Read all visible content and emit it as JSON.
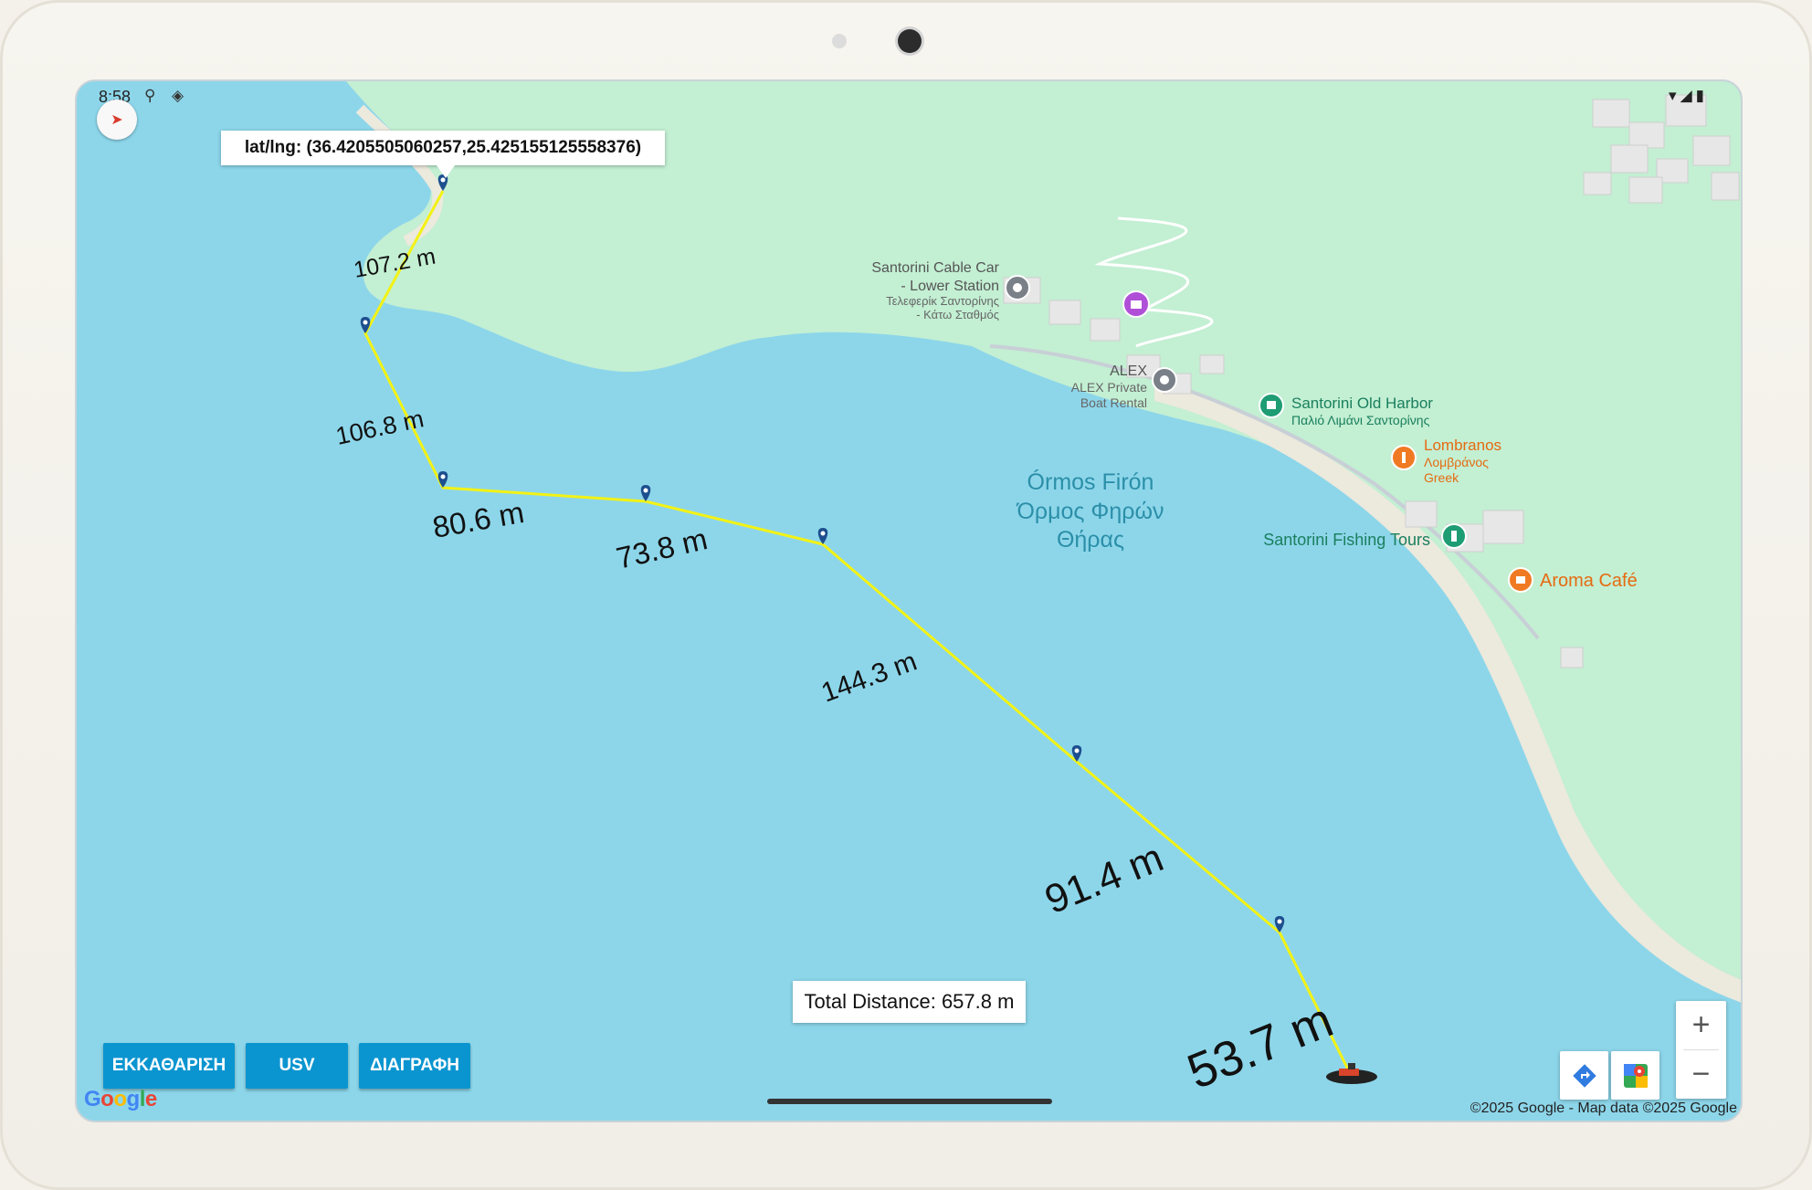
{
  "status_bar": {
    "time": "8:58",
    "right_icons": "▾◢▮"
  },
  "map": {
    "info_window_text": "lat/lng: (36.4205505060257,25.425155125558376)",
    "segment_labels": [
      "107.2 m",
      "106.8 m",
      "80.6 m",
      "73.8 m",
      "144.3 m",
      "91.4 m",
      "53.7 m"
    ],
    "total_distance": "Total Distance: 657.8 m",
    "bay_label": [
      "Órmos Firón",
      "Όρμος Φηρών",
      "Θήρας"
    ],
    "places": {
      "cable_car": [
        "Santorini Cable Car",
        "- Lower Station",
        "Τελεφερίκ Σαντορίνης",
        "- Κάτω Σταθμός"
      ],
      "alex": [
        "ALEX",
        "ALEX Private",
        "Boat Rental"
      ],
      "old_harbor": [
        "Santorini Old Harbor",
        "Παλιό Λιμάνι Σαντορίνης"
      ],
      "lombranos": [
        "Lombranos",
        "Λομβράνος",
        "Greek"
      ],
      "fishing_tours": "Santorini Fishing Tours",
      "aroma": "Aroma Café"
    },
    "route_color": "#f2f215",
    "water_color": "#8dd6ea",
    "land_color": "#c3efd3",
    "marker_color": "#1d4f8f"
  },
  "buttons": {
    "clear": "ΕΚΚΑΘΑΡΙΣΗ",
    "usv": "USV",
    "delete": "ΔΙΑΓΡΑΦΗ"
  },
  "zoom": {
    "in": "+",
    "out": "−"
  },
  "attribution": {
    "google": "Google",
    "copyright": "©2025 Google - Map data ©2025 Google"
  }
}
